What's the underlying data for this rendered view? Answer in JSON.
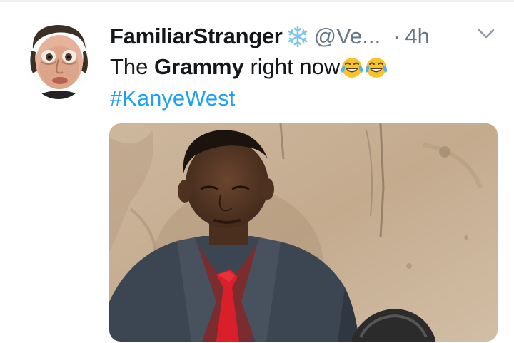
{
  "tweet": {
    "display_name": "FamiliarStranger",
    "handle": "@Ve...",
    "separator": "·",
    "time": "4h",
    "text_before": "The ",
    "text_bold": "Grammy",
    "text_after": " right now",
    "emoji": [
      "face-with-tears-of-joy-icon",
      "face-with-tears-of-joy-icon"
    ],
    "hashtag": "#KanyeWest"
  },
  "icons": {
    "badge": "snowflake-icon",
    "menu": "chevron-down-icon"
  },
  "colors": {
    "text": "#14171a",
    "secondary": "#657786",
    "link": "#1da1f2",
    "snowflake": "#7fc4ea"
  }
}
